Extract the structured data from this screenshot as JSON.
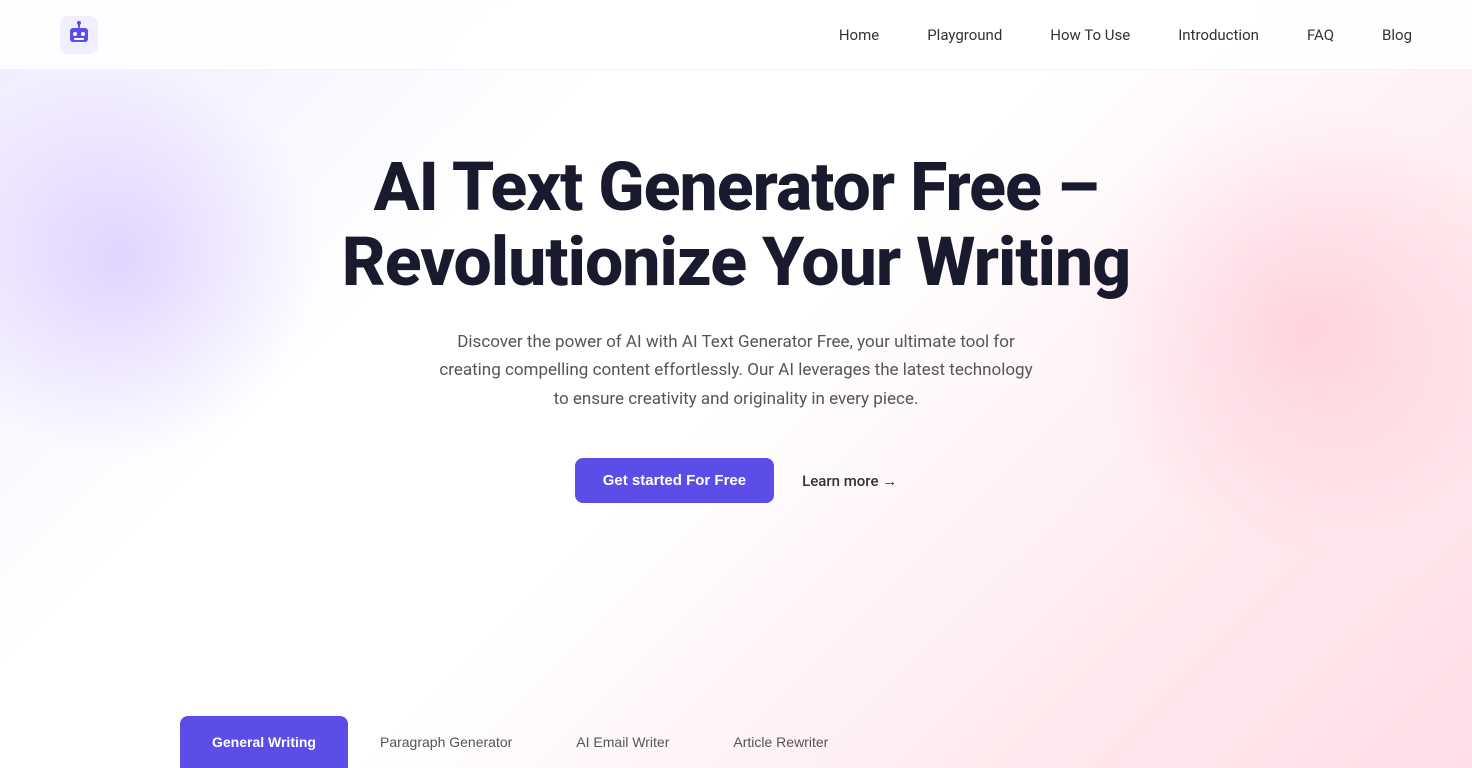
{
  "meta": {
    "title": "AI Text Generator Free"
  },
  "nav": {
    "logo_alt": "AI Text Generator Logo",
    "links": [
      {
        "id": "home",
        "label": "Home",
        "href": "#"
      },
      {
        "id": "playground",
        "label": "Playground",
        "href": "#"
      },
      {
        "id": "how-to-use",
        "label": "How To Use",
        "href": "#"
      },
      {
        "id": "introduction",
        "label": "Introduction",
        "href": "#"
      },
      {
        "id": "faq",
        "label": "FAQ",
        "href": "#"
      },
      {
        "id": "blog",
        "label": "Blog",
        "href": "#"
      }
    ]
  },
  "hero": {
    "title": "AI Text Generator Free – Revolutionize Your Writing",
    "subtitle": "Discover the power of AI with AI Text Generator Free, your ultimate tool for creating compelling content effortlessly. Our AI leverages the latest technology to ensure creativity and originality in every piece.",
    "cta_primary": "Get started For Free",
    "cta_secondary": "Learn more →"
  },
  "tabs": [
    {
      "id": "general-writing",
      "label": "General Writing",
      "active": true
    },
    {
      "id": "paragraph-generator",
      "label": "Paragraph Generator",
      "active": false
    },
    {
      "id": "ai-email-writer",
      "label": "AI  Email Writer",
      "active": false
    },
    {
      "id": "article-rewriter",
      "label": "Article Rewriter",
      "active": false
    }
  ],
  "colors": {
    "primary": "#5b4de8",
    "primary_hover": "#4a3dd0",
    "text_dark": "#1a1a2e",
    "text_muted": "#555555"
  }
}
